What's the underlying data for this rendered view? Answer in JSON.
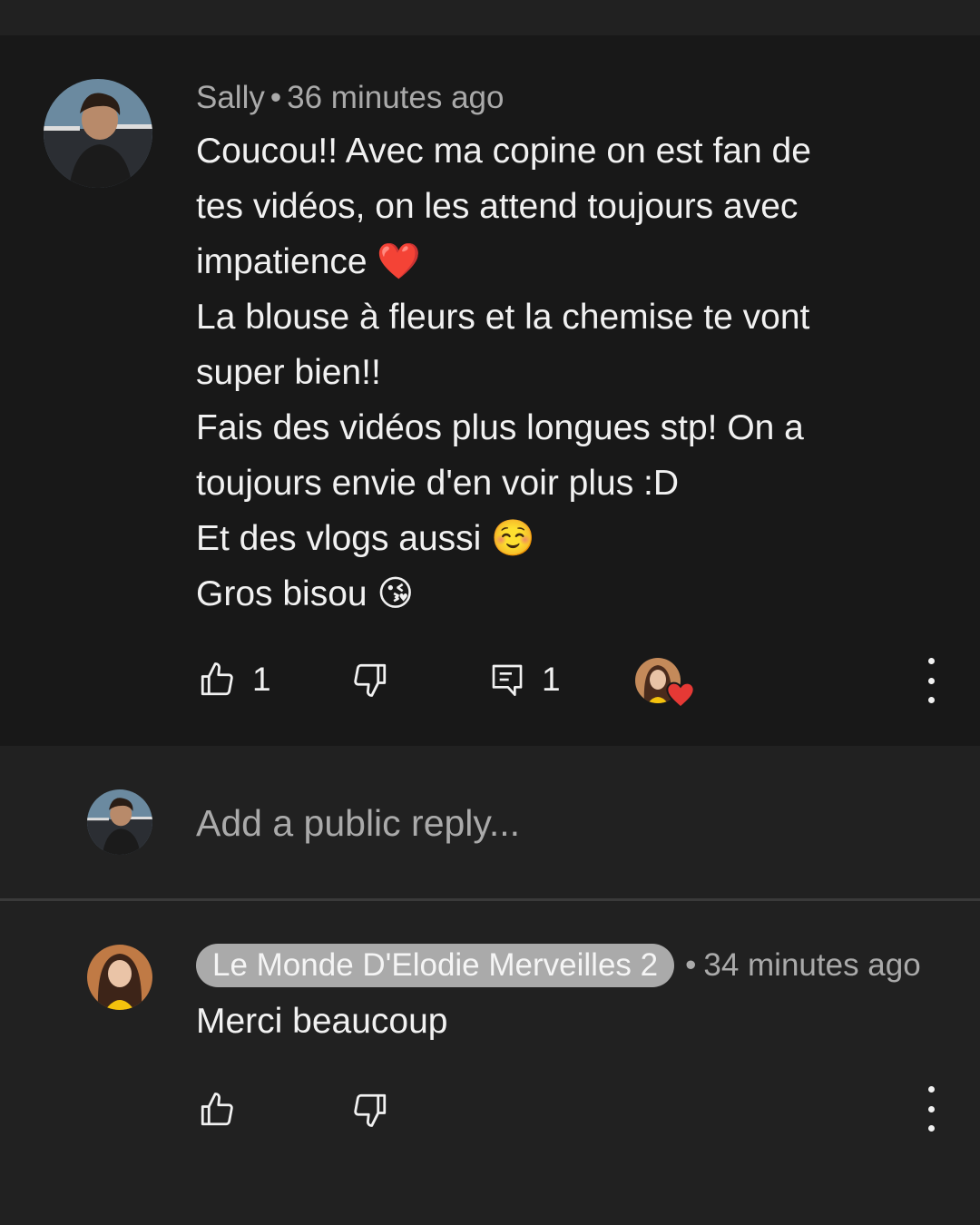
{
  "comment": {
    "author": "Sally",
    "separator": "•",
    "time": "36 minutes ago",
    "lines": [
      "Coucou!! Avec ma copine on est fan de",
      "tes vidéos, on les attend toujours avec",
      "impatience ❤️",
      "La blouse à fleurs et la chemise te vont",
      "super bien!!",
      "Fais des vidéos plus longues stp! On a",
      "toujours envie d'en voir plus :D",
      "Et des vlogs aussi ☺️",
      "Gros bisou 😘"
    ],
    "like_count": "1",
    "reply_count": "1",
    "icons": {
      "like": "thumbs-up-icon",
      "dislike": "thumbs-down-icon",
      "reply": "comment-icon",
      "more": "more-vertical-icon",
      "creator_heart": "heart-icon"
    }
  },
  "reply_box": {
    "placeholder": "Add a public reply..."
  },
  "reply": {
    "author": "Le Monde D'Elodie Merveilles 2",
    "separator": "•",
    "time": "34 minutes ago",
    "text": "Merci beaucoup"
  },
  "colors": {
    "background": "#212121",
    "comment_highlight": "#181818",
    "text_primary": "#f1f1f1",
    "text_secondary": "#aaaaaa",
    "heart": "#e53935"
  }
}
